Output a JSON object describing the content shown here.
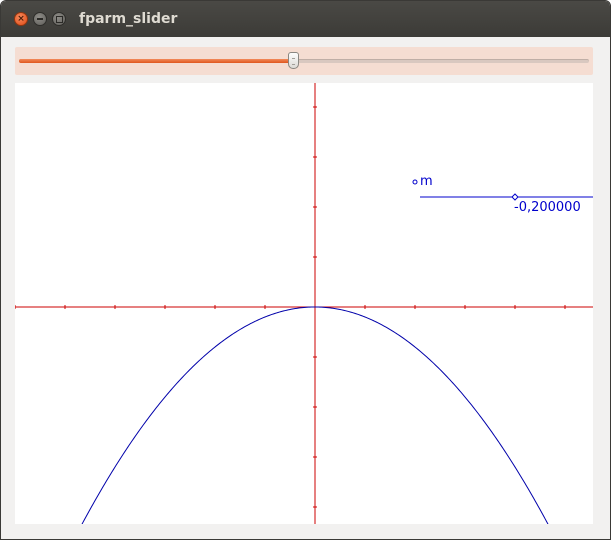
{
  "window": {
    "title": "fparm_slider",
    "buttons": {
      "close_icon": "close-icon",
      "minimize_icon": "minimize-icon",
      "maximize_icon": "maximize-icon",
      "close_glyph": "×"
    }
  },
  "slider": {
    "value_fraction": 0.48,
    "fill_color": "#e66b35",
    "panel_color": "#f5ddd2"
  },
  "chart_data": {
    "type": "line",
    "function": "y = m * x^2",
    "parameter": {
      "name": "m",
      "value": -0.2,
      "value_text": "-0,200000",
      "color": "#0000cc"
    },
    "xlim": [
      -6,
      5.56
    ],
    "ylim": [
      -4.34,
      4.48
    ],
    "x_tick_step": 1,
    "y_tick_step": 1,
    "axis_color": "#cc0000",
    "curve_color": "#0000aa",
    "grid": false
  }
}
